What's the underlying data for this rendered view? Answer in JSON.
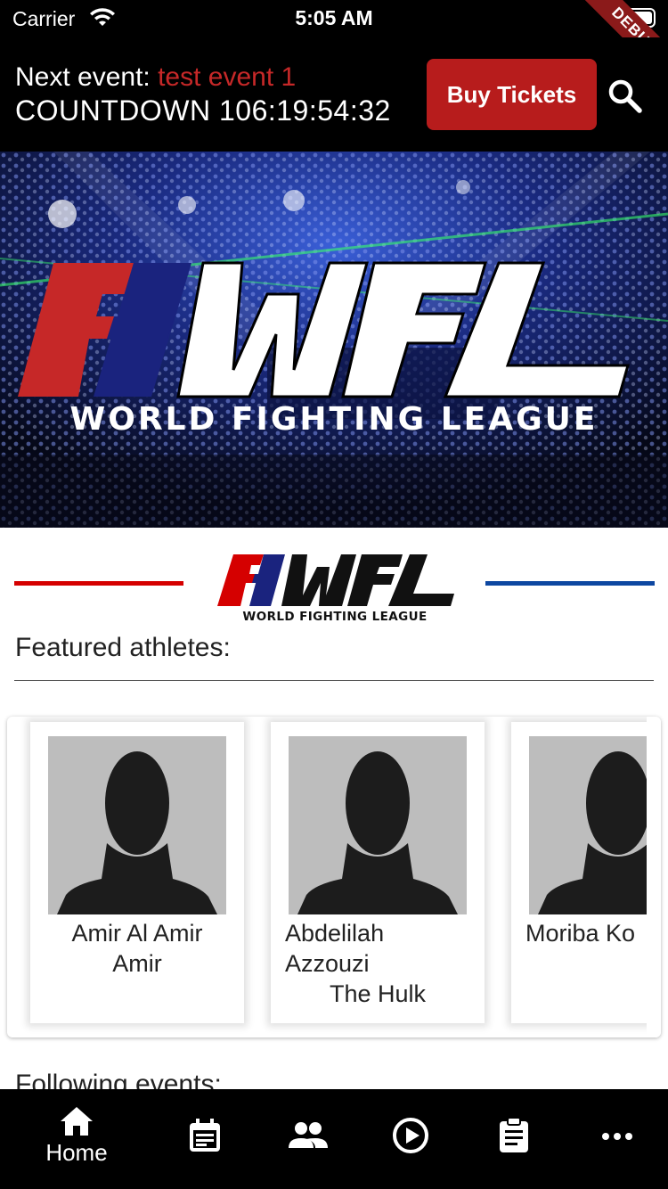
{
  "status_bar": {
    "carrier": "Carrier",
    "time": "5:05 AM",
    "debug_label": "DEBUG"
  },
  "header": {
    "next_event_label": "Next event:",
    "next_event_name": "test event 1",
    "countdown": "COUNTDOWN 106:19:54:32",
    "buy_tickets_label": "Buy Tickets",
    "search_icon": "search-icon"
  },
  "hero": {
    "logo_text": "WFL",
    "tagline": "WORLD FIGHTING LEAGUE"
  },
  "brand": {
    "logo_text": "WFL",
    "tagline": "WORLD FIGHTING LEAGUE",
    "red": "#d50000",
    "blue": "#0d47a1"
  },
  "featured": {
    "title": "Featured athletes:",
    "athletes": [
      {
        "name": "Amir Al Amir Amir",
        "nickname": ""
      },
      {
        "name": "Abdelilah Azzouzi",
        "nickname": "The Hulk"
      },
      {
        "name": "Moriba Ko",
        "nickname": ""
      }
    ]
  },
  "following": {
    "title": "Following events:"
  },
  "bottom_nav": {
    "items": [
      {
        "icon": "home-icon",
        "label": "Home",
        "active": true
      },
      {
        "icon": "calendar-icon",
        "label": ""
      },
      {
        "icon": "people-icon",
        "label": ""
      },
      {
        "icon": "play-circle-icon",
        "label": ""
      },
      {
        "icon": "clipboard-icon",
        "label": ""
      },
      {
        "icon": "more-horizontal-icon",
        "label": ""
      }
    ]
  },
  "colors": {
    "accent_red": "#b71c1c",
    "event_name_red": "#c62828",
    "background_dark": "#000000"
  }
}
